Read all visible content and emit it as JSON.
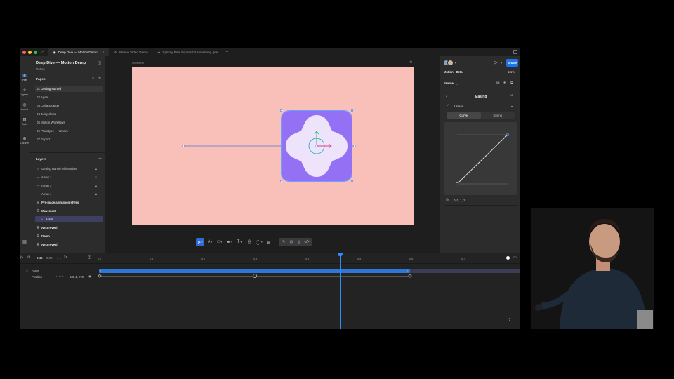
{
  "titlebar": {
    "tabs": [
      {
        "label": "Deep Dive — Motion Demo",
        "active": true
      },
      {
        "label": "Weave Video Demo",
        "active": false
      },
      {
        "label": "Splinny Pink Square Of something gee",
        "active": false
      }
    ],
    "new_tab": "+",
    "close": "×"
  },
  "iconbar": {
    "items": [
      {
        "label": "File",
        "icon": "file-icon"
      },
      {
        "label": "Agents",
        "icon": "agents-icon"
      },
      {
        "label": "Assets",
        "icon": "assets-icon"
      },
      {
        "label": "Tools",
        "icon": "tools-icon"
      },
      {
        "label": "Libraries",
        "icon": "libraries-icon"
      }
    ]
  },
  "left_panel": {
    "project_title": "Deep Dive — Motion Demo",
    "project_sub": "Motion",
    "pages_header": "Pages",
    "pages": [
      "01 Getting started",
      "02 Agent",
      "03 Collaboration",
      "04 Juicy demo",
      "05 Motion Workflows",
      "06 Prototype — Weave",
      "07 Export"
    ],
    "layers_header": "Layers",
    "layers": [
      {
        "label": "Getting started with Motion",
        "icon": "T",
        "indent": 0,
        "lock": true,
        "bold": false
      },
      {
        "label": "Arrow 1",
        "icon": "—",
        "indent": 0,
        "lock": true,
        "bold": false
      },
      {
        "label": "Arrow 3",
        "icon": "—",
        "indent": 0,
        "lock": true,
        "bold": false
      },
      {
        "label": "Arrow 4",
        "icon": "—",
        "indent": 0,
        "lock": true,
        "bold": false
      },
      {
        "label": "Pre-made animation styles",
        "icon": "⠿",
        "indent": 0,
        "lock": false,
        "bold": true
      },
      {
        "label": "Movement",
        "icon": "⠿",
        "indent": 0,
        "lock": false,
        "bold": true
      },
      {
        "label": "Asset",
        "icon": "⠿",
        "indent": 1,
        "lock": false,
        "bold": false,
        "selected": true
      },
      {
        "label": "Next reveal",
        "icon": "⠿",
        "indent": 0,
        "lock": false,
        "bold": true
      },
      {
        "label": "Demo",
        "icon": "⠿",
        "indent": 0,
        "lock": false,
        "bold": true
      },
      {
        "label": "Next reveal",
        "icon": "⠿",
        "indent": 0,
        "lock": false,
        "bold": true
      }
    ]
  },
  "canvas": {
    "frame_label": "Movement",
    "frame_color": "#f8c0b9",
    "asset_color": "#9470f5",
    "blob_color": "#ede3fb"
  },
  "right_panel": {
    "file_name": "Motion · Beta",
    "zoom": "111%",
    "share_label": "Share",
    "frame_label": "Frame",
    "easing_title": "Easing",
    "easing_type": "Linear",
    "tabs": [
      "Curve",
      "Spring"
    ],
    "curve_value": "0, 0, 1, 1"
  },
  "timeline": {
    "current_time": "0.46",
    "duration": "0.80",
    "ticks": [
      "0.0",
      "0.1",
      "0.2",
      "0.3",
      "0.4",
      "0.5",
      "0.6",
      "0.7"
    ],
    "track_label": "Asset",
    "property_label": "Position",
    "property_value": "639.4, 270",
    "help": "?"
  }
}
